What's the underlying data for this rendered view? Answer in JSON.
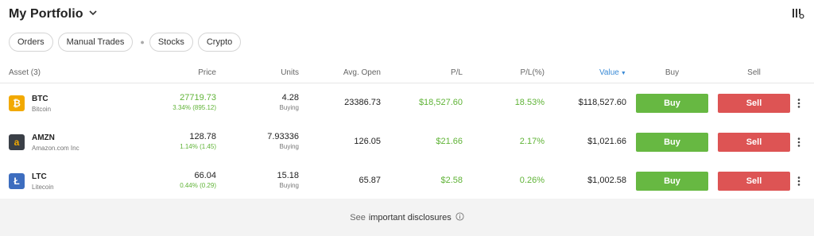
{
  "header": {
    "title": "My Portfolio"
  },
  "filters": [
    "Orders",
    "Manual Trades",
    "Stocks",
    "Crypto"
  ],
  "columns": {
    "asset": "Asset (3)",
    "price": "Price",
    "units": "Units",
    "avg_open": "Avg. Open",
    "pl": "P/L",
    "pl_pct": "P/L(%)",
    "value": "Value",
    "buy": "Buy",
    "sell": "Sell"
  },
  "rows": [
    {
      "symbol": "BTC",
      "name": "Bitcoin",
      "logo_char": "₿",
      "logo_color": "#f2a900",
      "price": "27719.73",
      "price_change": "3.34% (895.12)",
      "units": "4.28",
      "units_sub": "Buying",
      "avg_open": "23386.73",
      "pl": "$18,527.60",
      "pl_pct": "18.53%",
      "value": "$118,527.60",
      "buy_label": "Buy",
      "sell_label": "Sell"
    },
    {
      "symbol": "AMZN",
      "name": "Amazon.com Inc",
      "logo_char": "a",
      "logo_color": "#3a3f47",
      "price": "128.78",
      "price_change": "1.14% (1.45)",
      "units": "7.93336",
      "units_sub": "Buying",
      "avg_open": "126.05",
      "pl": "$21.66",
      "pl_pct": "2.17%",
      "value": "$1,021.66",
      "buy_label": "Buy",
      "sell_label": "Sell"
    },
    {
      "symbol": "LTC",
      "name": "Litecoin",
      "logo_char": "Ł",
      "logo_color": "#3d6dbf",
      "price": "66.04",
      "price_change": "0.44% (0.29)",
      "units": "15.18",
      "units_sub": "Buying",
      "avg_open": "65.87",
      "pl": "$2.58",
      "pl_pct": "0.26%",
      "value": "$1,002.58",
      "buy_label": "Buy",
      "sell_label": "Sell"
    }
  ],
  "footer": {
    "prefix": "See",
    "link": "important disclosures"
  },
  "colors": {
    "green": "#5fb336",
    "buy": "#67b842",
    "sell": "#dd5454",
    "accent": "#3b8bd6"
  },
  "icons": [
    "chevron-down-icon",
    "columns-settings-icon",
    "kebab-menu-icon",
    "info-icon"
  ]
}
